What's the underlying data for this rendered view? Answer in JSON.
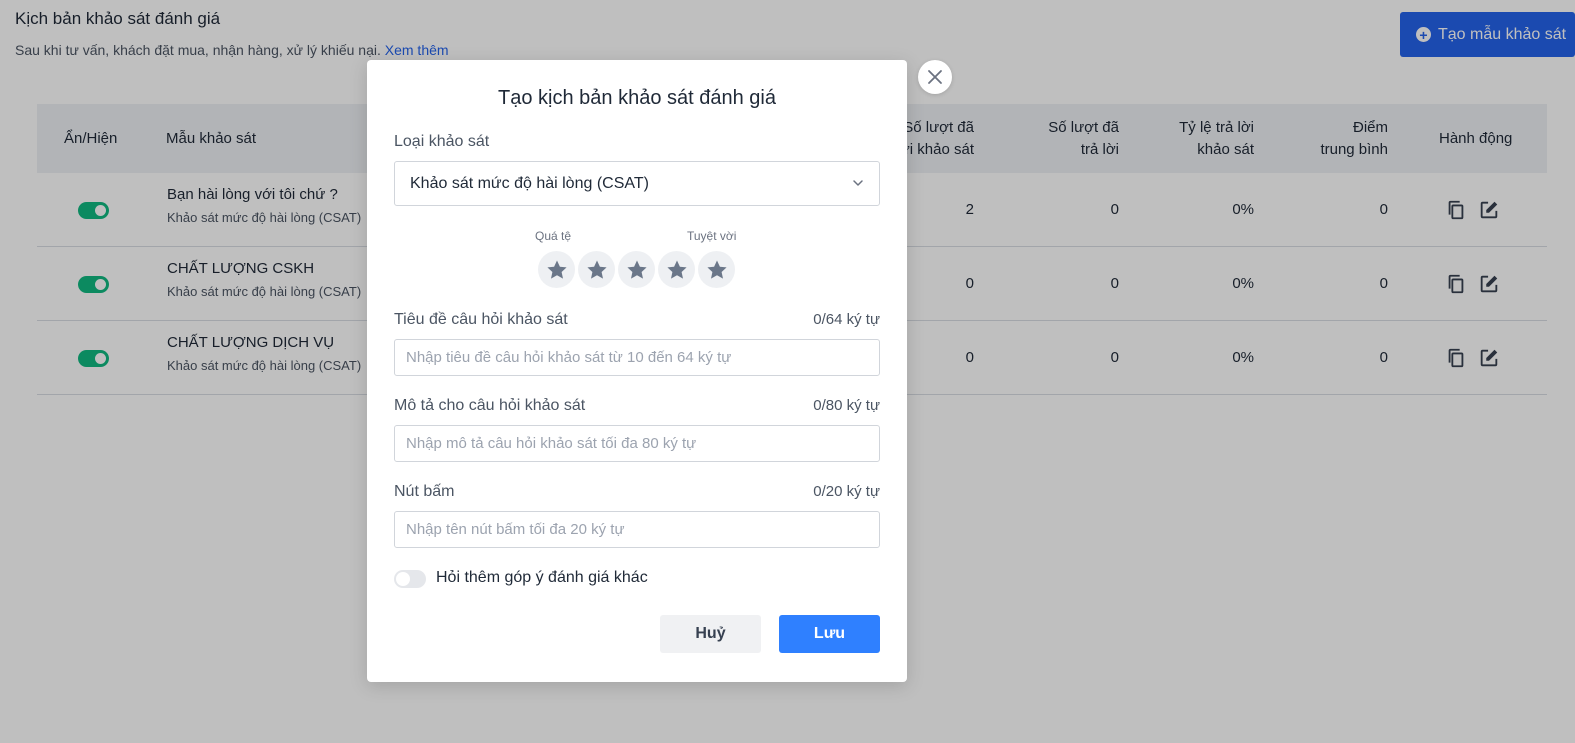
{
  "page": {
    "title": "Kịch bản khảo sát đánh giá",
    "subtitle": "Sau khi tư vấn, khách đặt mua, nhận hàng, xử lý khiếu nại.",
    "see_more": "Xem thêm",
    "create_button": "Tạo mẫu khảo sát"
  },
  "table": {
    "headers": {
      "visibility": "Ẩn/Hiện",
      "template": "Mẫu khảo sát",
      "sent_1": "Số lượt đã",
      "sent_2": "gửi khảo sát",
      "answered_1": "Số lượt đã",
      "answered_2": "trả lời",
      "rate_1": "Tỷ lệ trả lời",
      "rate_2": "khảo sát",
      "score_1": "Điểm",
      "score_2": "trung bình",
      "actions": "Hành động"
    },
    "rows": [
      {
        "name": "Bạn hài lòng với tôi chứ ?",
        "type": "Khảo sát mức độ hài lòng (CSAT)",
        "sent": "2",
        "answered": "0",
        "rate": "0%",
        "score": "0",
        "visible": true
      },
      {
        "name": "CHẤT LƯỢNG CSKH",
        "type": "Khảo sát mức độ hài lòng (CSAT)",
        "sent": "0",
        "answered": "0",
        "rate": "0%",
        "score": "0",
        "visible": true
      },
      {
        "name": "CHẤT LƯỢNG DỊCH VỤ",
        "type": "Khảo sát mức độ hài lòng (CSAT)",
        "sent": "0",
        "answered": "0",
        "rate": "0%",
        "score": "0",
        "visible": true
      }
    ]
  },
  "modal": {
    "title": "Tạo kịch bản khảo sát đánh giá",
    "survey_type_label": "Loại khảo sát",
    "survey_type_value": "Khảo sát mức độ hài lòng (CSAT)",
    "rating_low": "Quá tệ",
    "rating_high": "Tuyệt vời",
    "star_count": 5,
    "question_title_label": "Tiêu đề câu hỏi khảo sát",
    "question_title_counter": "0/64 ký tự",
    "question_title_placeholder": "Nhập tiêu đề câu hỏi khảo sát từ 10 đến 64 ký tự",
    "description_label": "Mô tả cho câu hỏi khảo sát",
    "description_counter": "0/80 ký tự",
    "description_placeholder": "Nhập mô tả câu hỏi khảo sát tối đa 80 ký tự",
    "button_label": "Nút bấm",
    "button_counter": "0/20 ký tự",
    "button_placeholder": "Nhập tên nút bấm tối đa 20 ký tự",
    "extra_feedback_label": "Hỏi thêm góp ý đánh giá khác",
    "extra_feedback_on": false,
    "cancel": "Huỷ",
    "save": "Lưu"
  },
  "colors": {
    "primary": "#2563eb",
    "save_button": "#2f80ff",
    "toggle_on": "#10b981",
    "star": "#6b7789"
  }
}
